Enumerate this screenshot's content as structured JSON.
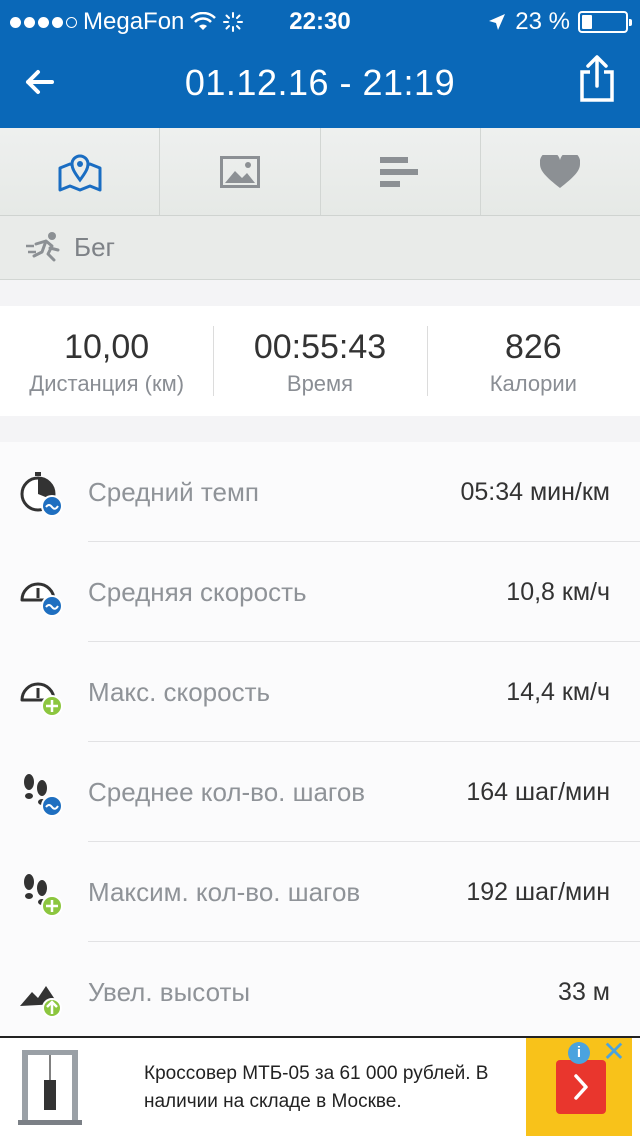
{
  "status_bar": {
    "carrier": "MegaFon",
    "time": "22:30",
    "battery": "23 %",
    "battery_level": 0.23
  },
  "header": {
    "title": "01.12.16 - 21:19",
    "back_icon": "arrow-left-icon",
    "share_icon": "share-icon"
  },
  "tabs": [
    {
      "name": "map",
      "icon": "map-icon",
      "active": true
    },
    {
      "name": "photos",
      "icon": "image-icon",
      "active": false
    },
    {
      "name": "stats",
      "icon": "bars-icon",
      "active": false
    },
    {
      "name": "heart",
      "icon": "heart-icon",
      "active": false
    }
  ],
  "activity": {
    "label": "Бег",
    "icon": "runner-icon"
  },
  "summary": [
    {
      "value": "10,00",
      "label": "Дистанция (км)"
    },
    {
      "value": "00:55:43",
      "label": "Время"
    },
    {
      "value": "826",
      "label": "Калории"
    }
  ],
  "stats": [
    {
      "name": "Средний темп",
      "value": "05:34 мин/км",
      "icon": "avg-pace-icon"
    },
    {
      "name": "Средняя скорость",
      "value": "10,8 км/ч",
      "icon": "avg-speed-icon"
    },
    {
      "name": "Макс. скорость",
      "value": "14,4 км/ч",
      "icon": "max-speed-icon"
    },
    {
      "name": "Среднее кол-во. шагов",
      "value": "164 шаг/мин",
      "icon": "avg-steps-icon"
    },
    {
      "name": "Максим. кол-во. шагов",
      "value": "192 шаг/мин",
      "icon": "max-steps-icon"
    },
    {
      "name": "Увел. высоты",
      "value": "33 м",
      "icon": "elevation-gain-icon"
    }
  ],
  "ad": {
    "text": "Кроссовер МТБ-05 за 61 000 рублей. В наличии на складе в Москве."
  },
  "colors": {
    "brand_blue": "#0a68b8",
    "avg_badge": "#1f6fc0",
    "max_badge": "#8cc63f",
    "ad_yellow": "#f8c21a",
    "ad_red": "#e9362d"
  }
}
